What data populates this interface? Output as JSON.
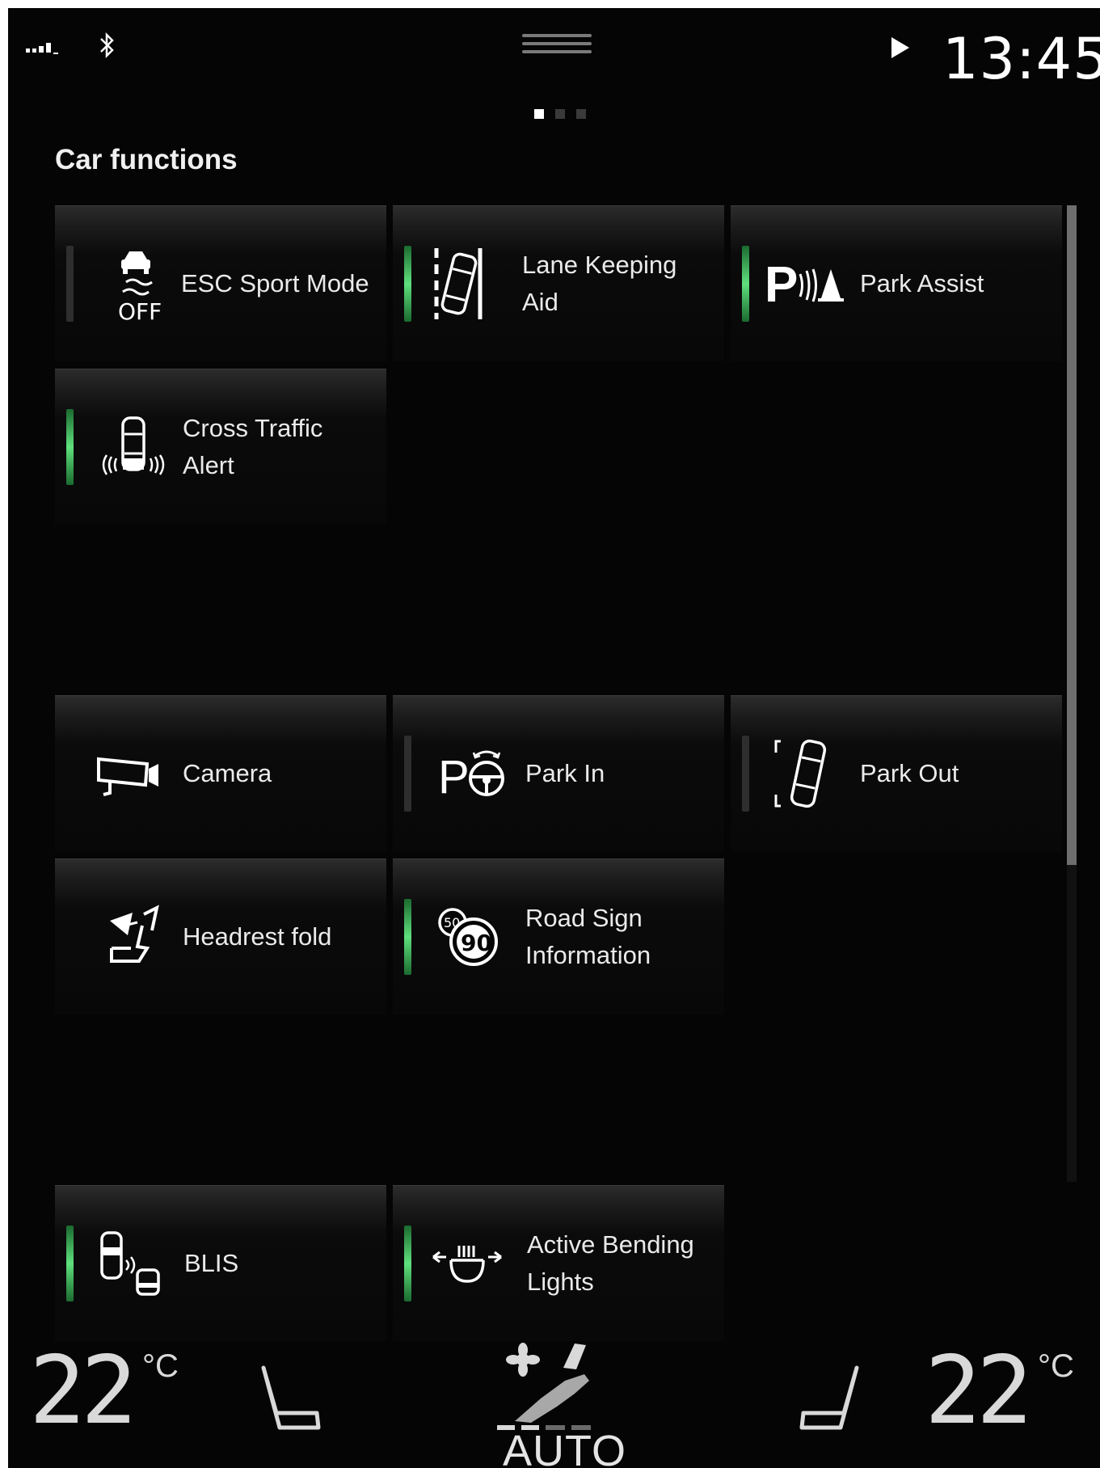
{
  "status": {
    "time": "13:45"
  },
  "page_indicator": {
    "count": 3,
    "active": 1
  },
  "section_title": "Car functions",
  "tiles": [
    {
      "label": "ESC Sport Mode",
      "icon": "esc-off-icon",
      "indicator": "off"
    },
    {
      "label": "Lane Keeping\nAid",
      "icon": "lane-keeping-icon",
      "indicator": "on"
    },
    {
      "label": "Park Assist",
      "icon": "park-assist-icon",
      "indicator": "on"
    },
    {
      "label": "Cross Traffic\nAlert",
      "icon": "cross-traffic-icon",
      "indicator": "on"
    },
    {
      "label": "Camera",
      "icon": "camera-icon",
      "indicator": "none"
    },
    {
      "label": "Park In",
      "icon": "park-in-icon",
      "indicator": "off"
    },
    {
      "label": "Park Out",
      "icon": "park-out-icon",
      "indicator": "off"
    },
    {
      "label": "Headrest fold",
      "icon": "headrest-fold-icon",
      "indicator": "none"
    },
    {
      "label": "Road Sign\nInformation",
      "icon": "road-sign-icon",
      "indicator": "on"
    },
    {
      "label": "BLIS",
      "icon": "blis-icon",
      "indicator": "on"
    },
    {
      "label": "Active Bending\nLights",
      "icon": "bending-lights-icon",
      "indicator": "on"
    }
  ],
  "climate": {
    "driver_temp": "22",
    "passenger_temp": "22",
    "unit": "°C",
    "auto_label": "AUTO"
  },
  "colors": {
    "active_indicator": "#5fe07c",
    "background": "#050505"
  }
}
